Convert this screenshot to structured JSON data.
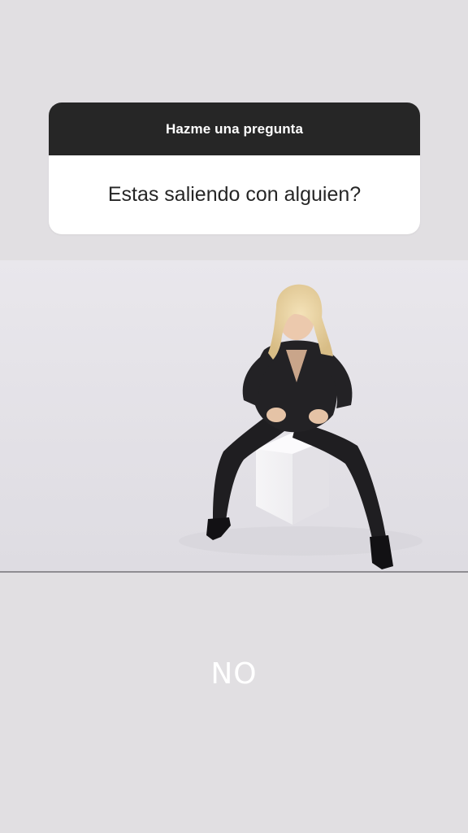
{
  "question_sticker": {
    "header": "Hazme una pregunta",
    "question": "Estas saliendo con alguien?"
  },
  "answer_text": "NO",
  "colors": {
    "background": "#e1dfe2",
    "header_bg": "#262626",
    "card_bg": "#ffffff",
    "answer_text": "#ffffff"
  },
  "photo": {
    "subject": "woman-in-black-suit-seated-on-white-cube"
  }
}
